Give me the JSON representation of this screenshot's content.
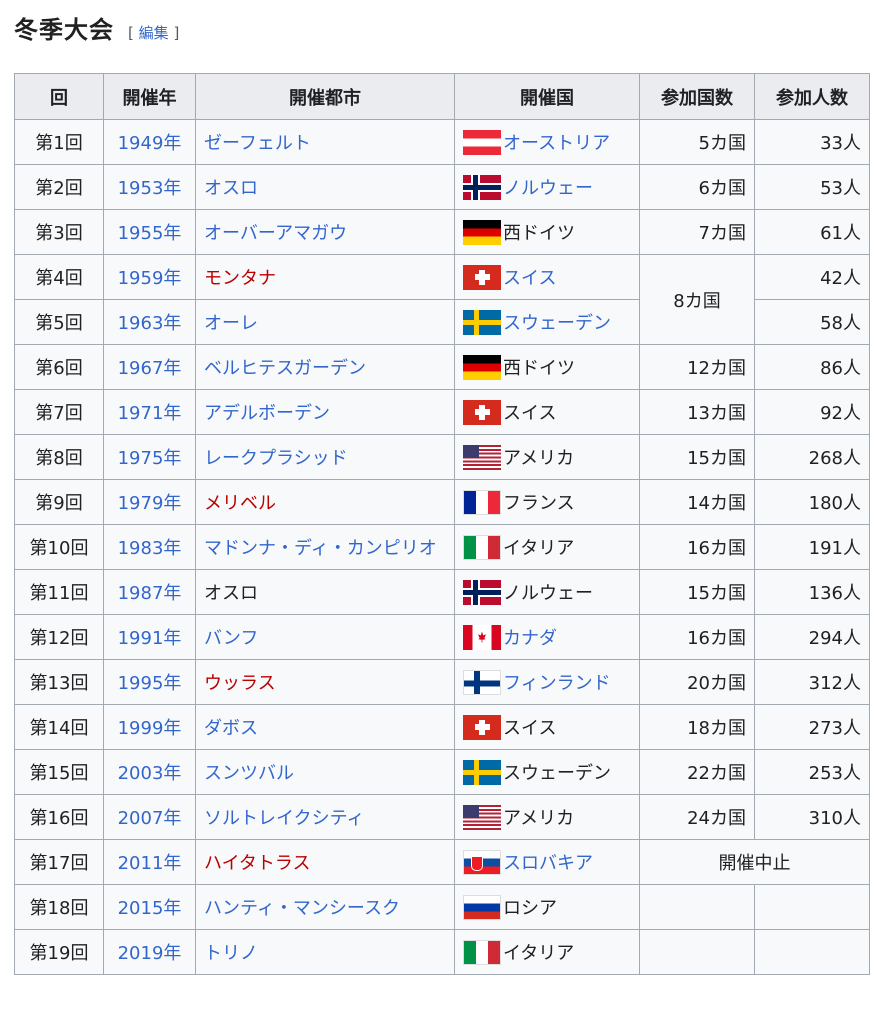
{
  "heading": {
    "title": "冬季大会",
    "edit_open": "[",
    "edit_label": "編集",
    "edit_close": "]"
  },
  "table": {
    "headers": [
      "回",
      "開催年",
      "開催都市",
      "開催国",
      "参加国数",
      "参加人数"
    ],
    "rows": [
      {
        "edition": "第1回",
        "year": "1949年",
        "city": "ゼーフェルト",
        "country": "オーストリア",
        "flag": "at",
        "nations": "5カ国",
        "athletes": "33人"
      },
      {
        "edition": "第2回",
        "year": "1953年",
        "city": "オスロ",
        "country": "ノルウェー",
        "flag": "no",
        "nations": "6カ国",
        "athletes": "53人"
      },
      {
        "edition": "第3回",
        "year": "1955年",
        "city": "オーバーアマガウ",
        "country": "西ドイツ",
        "flag": "de",
        "nations": "7カ国",
        "athletes": "61人"
      },
      {
        "edition": "第4回",
        "year": "1959年",
        "city": "モンタナ",
        "country": "スイス",
        "flag": "ch",
        "nations": "8カ国",
        "athletes": "42人"
      },
      {
        "edition": "第5回",
        "year": "1963年",
        "city": "オーレ",
        "country": "スウェーデン",
        "flag": "se",
        "athletes": "58人"
      },
      {
        "edition": "第6回",
        "year": "1967年",
        "city": "ベルヒテスガーデン",
        "country": "西ドイツ",
        "flag": "de",
        "nations": "12カ国",
        "athletes": "86人"
      },
      {
        "edition": "第7回",
        "year": "1971年",
        "city": "アデルボーデン",
        "country": "スイス",
        "flag": "ch",
        "nations": "13カ国",
        "athletes": "92人"
      },
      {
        "edition": "第8回",
        "year": "1975年",
        "city": "レークプラシッド",
        "country": "アメリカ",
        "flag": "us",
        "nations": "15カ国",
        "athletes": "268人"
      },
      {
        "edition": "第9回",
        "year": "1979年",
        "city": "メリベル",
        "country": "フランス",
        "flag": "fr",
        "nations": "14カ国",
        "athletes": "180人"
      },
      {
        "edition": "第10回",
        "year": "1983年",
        "city": "マドンナ・ディ・カンピリオ",
        "country": "イタリア",
        "flag": "it",
        "nations": "16カ国",
        "athletes": "191人"
      },
      {
        "edition": "第11回",
        "year": "1987年",
        "city": "オスロ",
        "country": "ノルウェー",
        "flag": "no",
        "nations": "15カ国",
        "athletes": "136人"
      },
      {
        "edition": "第12回",
        "year": "1991年",
        "city": "バンフ",
        "country": "カナダ",
        "flag": "ca",
        "nations": "16カ国",
        "athletes": "294人"
      },
      {
        "edition": "第13回",
        "year": "1995年",
        "city": "ウッラス",
        "country": "フィンランド",
        "flag": "fi",
        "nations": "20カ国",
        "athletes": "312人"
      },
      {
        "edition": "第14回",
        "year": "1999年",
        "city": "ダボス",
        "country": "スイス",
        "flag": "ch",
        "nations": "18カ国",
        "athletes": "273人"
      },
      {
        "edition": "第15回",
        "year": "2003年",
        "city": "スンツバル",
        "country": "スウェーデン",
        "flag": "se",
        "nations": "22カ国",
        "athletes": "253人"
      },
      {
        "edition": "第16回",
        "year": "2007年",
        "city": "ソルトレイクシティ",
        "country": "アメリカ",
        "flag": "us",
        "nations": "24カ国",
        "athletes": "310人"
      },
      {
        "edition": "第17回",
        "year": "2011年",
        "city": "ハイタトラス",
        "country": "スロバキア",
        "flag": "sk",
        "note": "開催中止"
      },
      {
        "edition": "第18回",
        "year": "2015年",
        "city": "ハンティ・マンシースク",
        "country": "ロシア",
        "flag": "ru"
      },
      {
        "edition": "第19回",
        "year": "2019年",
        "city": "トリノ",
        "country": "イタリア",
        "flag": "it"
      }
    ]
  },
  "colors": {
    "link": "#3366cc",
    "redlink": "#ba0000",
    "header_bg": "#eaecf0",
    "cell_bg": "#f8f9fa",
    "border": "#a2a9b1"
  }
}
